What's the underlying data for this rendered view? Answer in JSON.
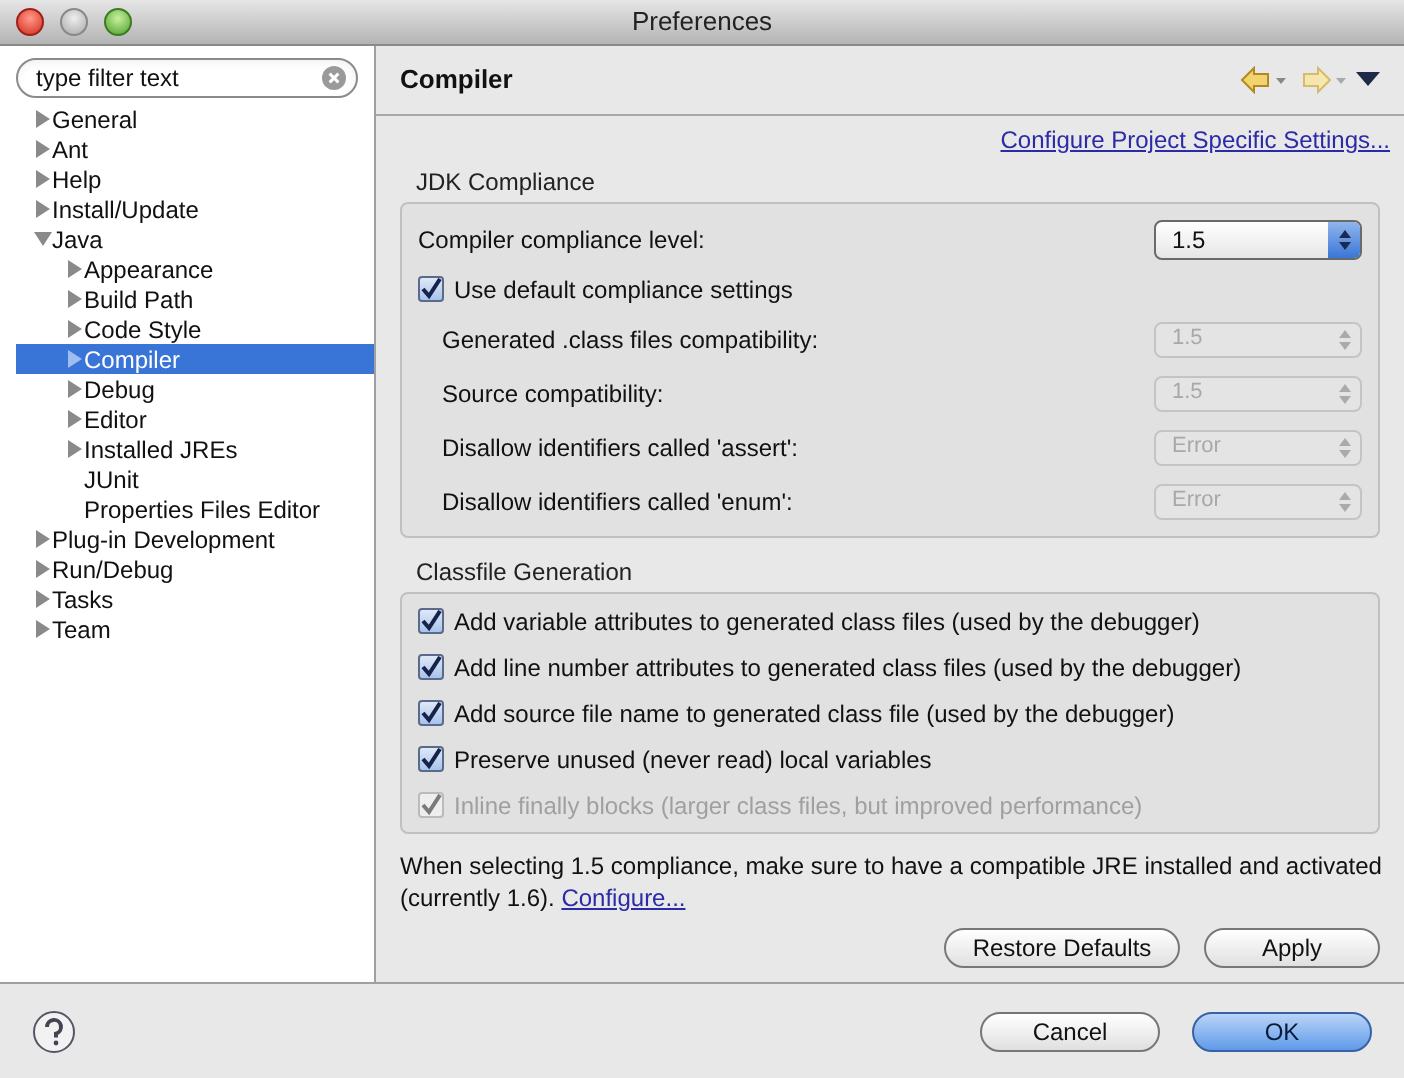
{
  "window": {
    "title": "Preferences"
  },
  "filter": {
    "placeholder": "type filter text"
  },
  "tree": [
    {
      "label": "General",
      "expandable": true,
      "expanded": false,
      "selected": false
    },
    {
      "label": "Ant",
      "expandable": true,
      "expanded": false,
      "selected": false
    },
    {
      "label": "Help",
      "expandable": true,
      "expanded": false,
      "selected": false
    },
    {
      "label": "Install/Update",
      "expandable": true,
      "expanded": false,
      "selected": false
    },
    {
      "label": "Java",
      "expandable": true,
      "expanded": true,
      "selected": false,
      "children": [
        {
          "label": "Appearance",
          "expandable": true,
          "expanded": false,
          "selected": false
        },
        {
          "label": "Build Path",
          "expandable": true,
          "expanded": false,
          "selected": false
        },
        {
          "label": "Code Style",
          "expandable": true,
          "expanded": false,
          "selected": false
        },
        {
          "label": "Compiler",
          "expandable": true,
          "expanded": false,
          "selected": true
        },
        {
          "label": "Debug",
          "expandable": true,
          "expanded": false,
          "selected": false
        },
        {
          "label": "Editor",
          "expandable": true,
          "expanded": false,
          "selected": false
        },
        {
          "label": "Installed JREs",
          "expandable": true,
          "expanded": false,
          "selected": false
        },
        {
          "label": "JUnit",
          "expandable": false,
          "selected": false
        },
        {
          "label": "Properties Files Editor",
          "expandable": false,
          "selected": false
        }
      ]
    },
    {
      "label": "Plug-in Development",
      "expandable": true,
      "expanded": false,
      "selected": false
    },
    {
      "label": "Run/Debug",
      "expandable": true,
      "expanded": false,
      "selected": false
    },
    {
      "label": "Tasks",
      "expandable": true,
      "expanded": false,
      "selected": false
    },
    {
      "label": "Team",
      "expandable": true,
      "expanded": false,
      "selected": false
    }
  ],
  "page": {
    "title": "Compiler",
    "project_link": "Configure Project Specific Settings...",
    "jdk_compliance": {
      "title": "JDK Compliance",
      "compliance_level": {
        "label": "Compiler compliance level:",
        "value": "1.5",
        "disabled": false
      },
      "use_default": {
        "label": "Use default compliance settings",
        "checked": true,
        "disabled": false
      },
      "settings": [
        {
          "label": "Generated .class files compatibility:",
          "value": "1.5",
          "disabled": true
        },
        {
          "label": "Source compatibility:",
          "value": "1.5",
          "disabled": true
        },
        {
          "label": "Disallow identifiers called 'assert':",
          "value": "Error",
          "disabled": true
        },
        {
          "label": "Disallow identifiers called 'enum':",
          "value": "Error",
          "disabled": true
        }
      ]
    },
    "classfile_generation": {
      "title": "Classfile Generation",
      "options": [
        {
          "label": "Add variable attributes to generated class files (used by the debugger)",
          "checked": true,
          "disabled": false
        },
        {
          "label": "Add line number attributes to generated class files (used by the debugger)",
          "checked": true,
          "disabled": false
        },
        {
          "label": "Add source file name to generated class file (used by the debugger)",
          "checked": true,
          "disabled": false
        },
        {
          "label": "Preserve unused (never read) local variables",
          "checked": true,
          "disabled": false
        },
        {
          "label": "Inline finally blocks (larger class files, but improved performance)",
          "checked": true,
          "disabled": true
        }
      ]
    },
    "note": {
      "text": "When selecting 1.5 compliance, make sure to have a compatible JRE installed and activated (currently 1.6). ",
      "link": "Configure..."
    },
    "buttons": [
      {
        "label": "Restore Defaults"
      },
      {
        "label": "Apply"
      }
    ]
  },
  "dialog_buttons": [
    {
      "label": "Cancel",
      "default": false
    },
    {
      "label": "OK",
      "default": true
    }
  ]
}
